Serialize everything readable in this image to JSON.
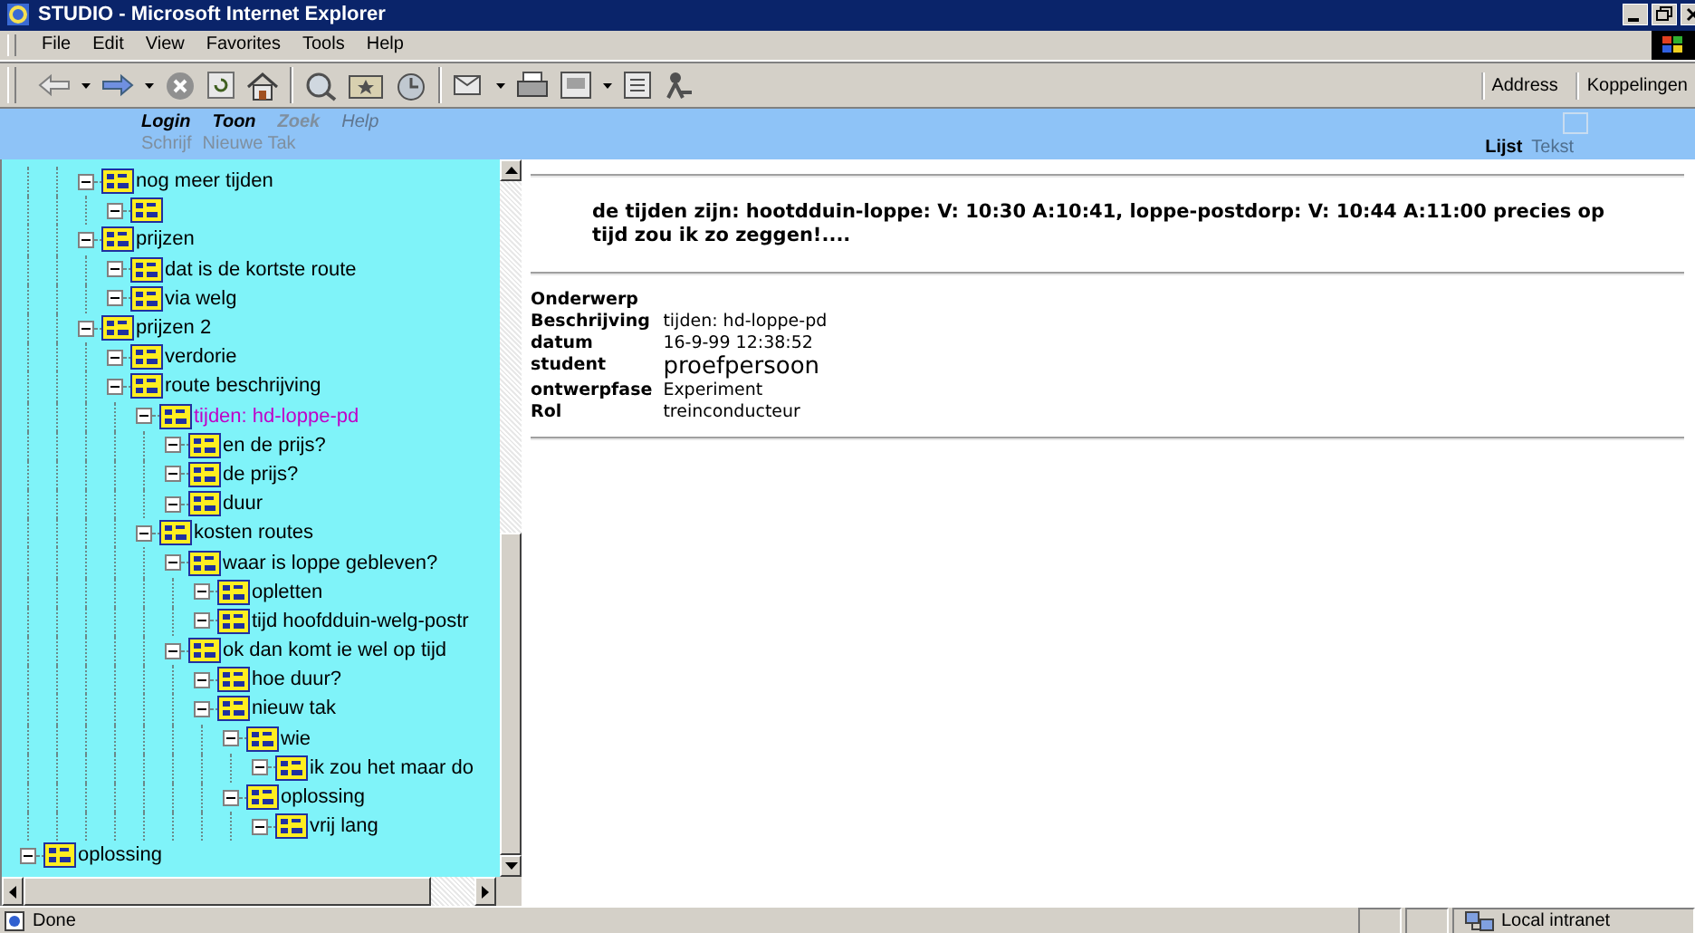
{
  "window": {
    "title": "STUDIO - Microsoft Internet Explorer"
  },
  "menu": [
    "File",
    "Edit",
    "View",
    "Favorites",
    "Tools",
    "Help"
  ],
  "toolbar": {
    "address_label": "Address",
    "links_label": "Koppelingen"
  },
  "nav": {
    "links": [
      {
        "label": "Login",
        "disabled": false
      },
      {
        "label": "Toon",
        "disabled": false
      },
      {
        "label": "Zoek",
        "disabled": true
      },
      {
        "label": "Help",
        "disabled": true
      }
    ],
    "sublinks": [
      {
        "label": "Schrijf",
        "disabled": true
      },
      {
        "label": "Nieuwe Tak",
        "disabled": true
      }
    ],
    "views": [
      {
        "label": "Lijst",
        "selected": true
      },
      {
        "label": "Tekst",
        "selected": false
      }
    ]
  },
  "tree": {
    "items": [
      {
        "children": [
          {
            "children": [
              {
                "label": "nog meer tijden",
                "selected": false,
                "children": [
                  {
                    "selected": false
                  }
                ]
              },
              {
                "label": "prijzen",
                "selected": false,
                "children": [
                  {
                    "label": "dat is de kortste route",
                    "selected": false
                  },
                  {
                    "label": "via welg",
                    "selected": false
                  }
                ]
              },
              {
                "label": "prijzen 2",
                "selected": false,
                "children": [
                  {
                    "label": "verdorie",
                    "selected": false
                  },
                  {
                    "label": "route beschrijving",
                    "selected": false,
                    "children": [
                      {
                        "label": "tijden: hd-loppe-pd",
                        "selected": true,
                        "children": [
                          {
                            "label": "en de prijs?",
                            "selected": false
                          },
                          {
                            "label": "de prijs?",
                            "selected": false
                          },
                          {
                            "label": "duur",
                            "selected": false
                          }
                        ]
                      },
                      {
                        "label": "kosten routes",
                        "selected": false,
                        "children": [
                          {
                            "label": "waar is loppe gebleven?",
                            "selected": false,
                            "children": [
                              {
                                "label": "opletten",
                                "selected": false
                              },
                              {
                                "label": "tijd hoofdduin-welg-postr",
                                "selected": false
                              }
                            ]
                          },
                          {
                            "label": "ok dan komt ie wel op tijd",
                            "selected": false,
                            "children": [
                              {
                                "label": "hoe duur?",
                                "selected": false
                              },
                              {
                                "label": "nieuw tak",
                                "selected": false,
                                "children": [
                                  {
                                    "label": "wie",
                                    "selected": false,
                                    "children": [
                                      {
                                        "label": "ik zou het maar do",
                                        "selected": false
                                      }
                                    ]
                                  },
                                  {
                                    "label": "oplossing",
                                    "selected": false,
                                    "children": [
                                      {
                                        "label": "vrij lang",
                                        "selected": false
                                      }
                                    ]
                                  }
                                ]
                              }
                            ]
                          }
                        ]
                      }
                    ]
                  }
                ]
              }
            ]
          }
        ]
      },
      {
        "label": "oplossing",
        "selected": false
      }
    ]
  },
  "message": "de tijden zijn: hootdduin-loppe: V: 10:30 A:10:41, loppe-postdorp: V: 10:44 A:11:00 precies op tijd zou ik zo zeggen!....",
  "details": [
    {
      "label": "Onderwerp"
    },
    {
      "label": "Beschrijving",
      "value": "tijden: hd-loppe-pd"
    },
    {
      "label": "datum",
      "value": "16-9-99 12:38:52"
    },
    {
      "label": "student",
      "value": "proefpersoon",
      "kind": "large"
    },
    {
      "label": "ontwerpfase",
      "value": "Experiment"
    },
    {
      "label": "Rol",
      "value": "treinconducteur"
    }
  ],
  "status_bar": {
    "text": "Done",
    "zone": "Local intranet"
  }
}
